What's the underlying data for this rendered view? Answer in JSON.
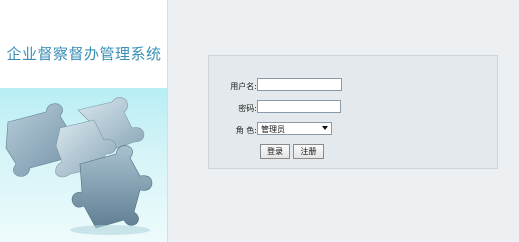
{
  "left_panel": {
    "title": "企业督察督办管理系统"
  },
  "login_form": {
    "username_label": "用户名:",
    "username_value": "",
    "password_label": "密码:",
    "password_value": "",
    "role_label": "角 色:",
    "role_selected": "管理员",
    "login_button_label": "登录",
    "register_button_label": "注册"
  },
  "icons": {
    "role_dropdown": "chevron-down-icon",
    "banner": "puzzle-pieces-illustration"
  }
}
